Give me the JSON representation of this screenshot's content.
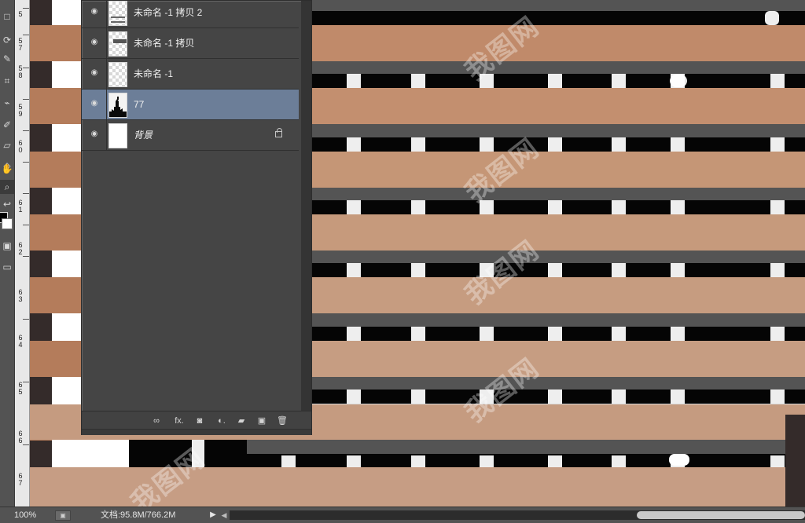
{
  "toolbar": {
    "tools": [
      {
        "name": "rectangle-marquee-icon",
        "symbol": "□"
      },
      {
        "name": "lasso-icon",
        "symbol": "⟳"
      },
      {
        "name": "quick-selection-icon",
        "symbol": "✎"
      },
      {
        "name": "crop-icon",
        "symbol": "⌗"
      },
      {
        "name": "eyedropper-icon",
        "symbol": "⌁"
      },
      {
        "name": "brush-icon",
        "symbol": "✐"
      },
      {
        "name": "eraser-icon",
        "symbol": "▱"
      },
      {
        "name": "gradient-icon",
        "symbol": "◇"
      },
      {
        "name": "hand-icon",
        "symbol": "✋"
      },
      {
        "name": "zoom-icon",
        "symbol": "⌕"
      },
      {
        "name": "swap-colors-icon",
        "symbol": "↩"
      },
      {
        "name": "quick-mask-icon",
        "symbol": "▣"
      },
      {
        "name": "screen-mode-icon",
        "symbol": "▭"
      }
    ],
    "foreground_color": "#000000",
    "background_color": "#ffffff"
  },
  "ruler": {
    "marks": [
      "5",
      "5\n7",
      "5\n8",
      "5\n9",
      "6\n0",
      "6\n1",
      "6\n2",
      "6\n3",
      "6\n4",
      "6\n5",
      "6\n6",
      "6\n7"
    ]
  },
  "layers_panel": {
    "layers": [
      {
        "name": "未命名 -1 拷贝 2",
        "thumbnail": "checker-stripes",
        "selected": false,
        "locked": false
      },
      {
        "name": "未命名 -1 拷贝",
        "thumbnail": "checker-block",
        "selected": false,
        "locked": false
      },
      {
        "name": "未命名 -1",
        "thumbnail": "checker",
        "selected": false,
        "locked": false
      },
      {
        "name": "77",
        "thumbnail": "silhouette",
        "selected": true,
        "locked": false
      },
      {
        "name": "背景",
        "thumbnail": "white",
        "selected": false,
        "locked": true
      }
    ],
    "footer_icons": [
      {
        "name": "link-layers-icon",
        "symbol": "∞"
      },
      {
        "name": "fx-icon",
        "symbol": "fx."
      },
      {
        "name": "layer-mask-icon",
        "symbol": "◙"
      },
      {
        "name": "adjustment-layer-icon",
        "symbol": "◐."
      },
      {
        "name": "group-folder-icon",
        "symbol": "▰"
      },
      {
        "name": "new-layer-icon",
        "symbol": "▣"
      },
      {
        "name": "delete-layer-icon",
        "symbol": "🗑"
      }
    ],
    "selected_color": "#6c7e98"
  },
  "status_bar": {
    "zoom": "100%",
    "doc_info": "文档:95.8M/766.2M",
    "menu_arrow": "▶",
    "scroll_left_arrow": "◀"
  },
  "canvas": {
    "colors": {
      "wood": "#c08a6a",
      "wood_light": "#c69c84",
      "dark_gray": "#545454",
      "black": "#050505",
      "white": "#eeeeee"
    }
  }
}
